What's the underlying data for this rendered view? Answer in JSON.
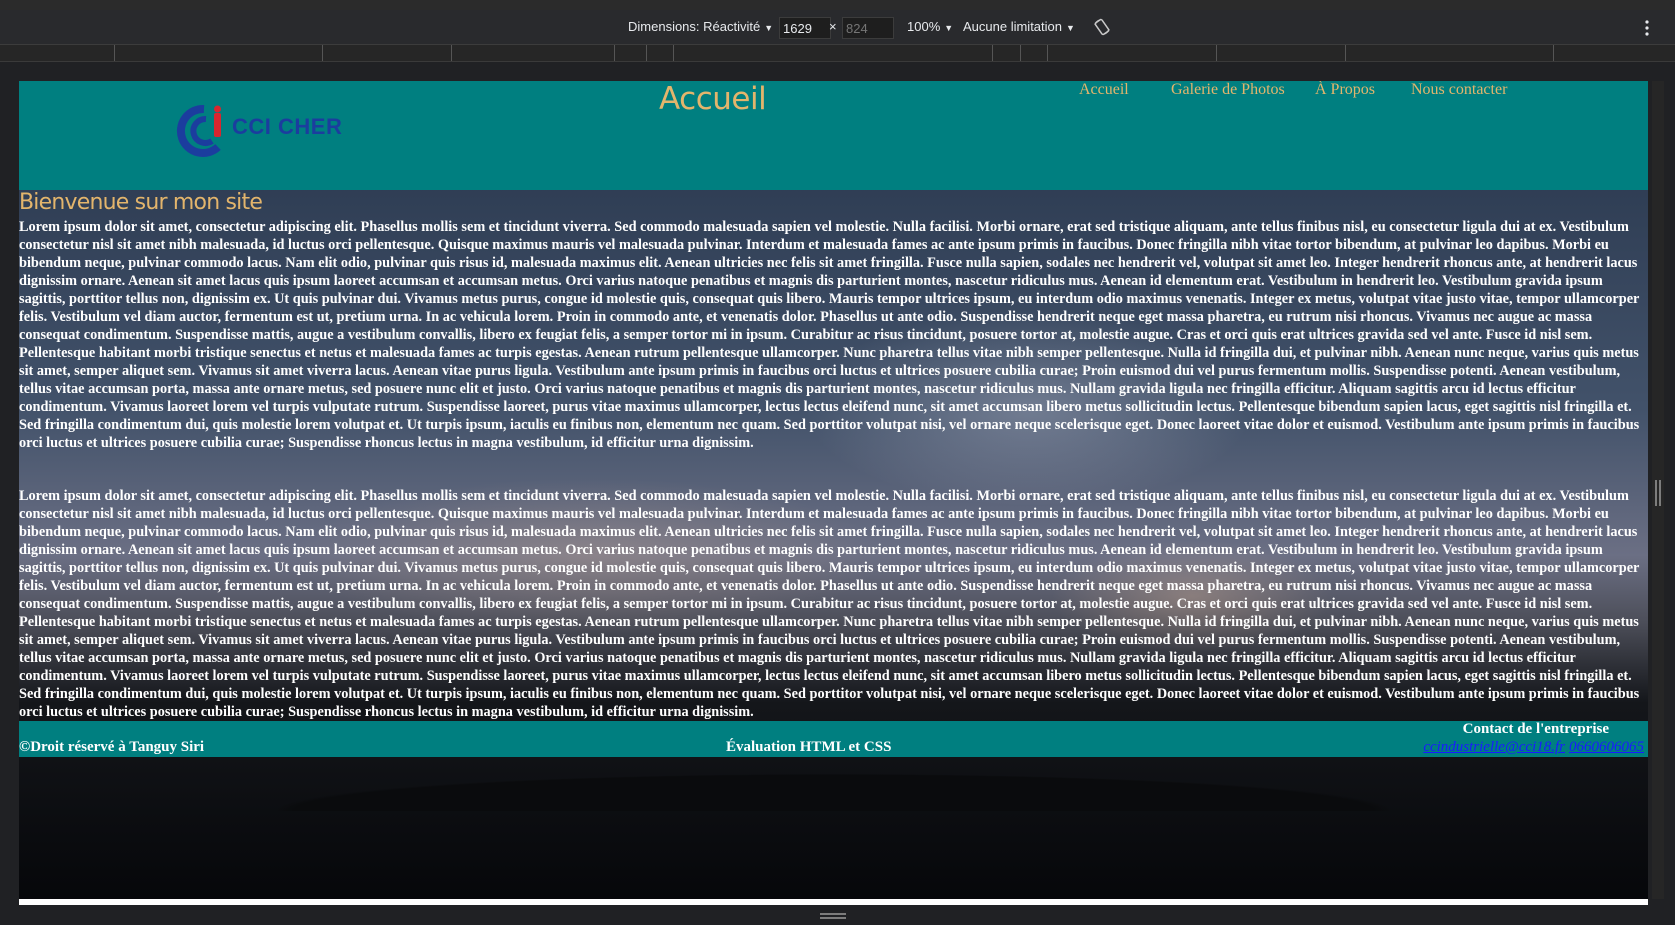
{
  "devtools": {
    "dimensions_label": "Dimensions: Réactivité",
    "width_value": "1629",
    "height_placeholder": "824",
    "times": "×",
    "zoom": "100%",
    "throttling": "Aucune limitation"
  },
  "site": {
    "logo_text": "CCI CHER",
    "page_title": "Accueil",
    "nav": [
      "Accueil",
      "Galerie de Photos",
      "À Propos",
      "Nous contacter"
    ],
    "welcome": "Bienvenue sur mon site",
    "paragraph": "Lorem ipsum dolor sit amet, consectetur adipiscing elit. Phasellus mollis sem et tincidunt viverra. Sed commodo malesuada sapien vel molestie. Nulla facilisi. Morbi ornare, erat sed tristique aliquam, ante tellus finibus nisl, eu consectetur ligula dui at ex. Vestibulum consectetur nisl sit amet nibh malesuada, id luctus orci pellentesque. Quisque maximus mauris vel malesuada pulvinar. Interdum et malesuada fames ac ante ipsum primis in faucibus. Donec fringilla nibh vitae tortor bibendum, at pulvinar leo dapibus. Morbi eu bibendum neque, pulvinar commodo lacus. Nam elit odio, pulvinar quis risus id, malesuada maximus elit. Aenean ultricies nec felis sit amet fringilla. Fusce nulla sapien, sodales nec hendrerit vel, volutpat sit amet leo. Integer hendrerit rhoncus ante, at hendrerit lacus dignissim ornare. Aenean sit amet lacus quis ipsum laoreet accumsan et accumsan metus. Orci varius natoque penatibus et magnis dis parturient montes, nascetur ridiculus mus. Aenean id elementum erat. Vestibulum in hendrerit leo. Vestibulum gravida ipsum sagittis, porttitor tellus non, dignissim ex. Ut quis pulvinar dui. Vivamus metus purus, congue id molestie quis, consequat quis libero. Mauris tempor ultrices ipsum, eu interdum odio maximus venenatis. Integer ex metus, volutpat vitae justo vitae, tempor ullamcorper felis. Vestibulum vel diam auctor, fermentum est ut, pretium urna. In ac vehicula lorem. Proin in commodo ante, et venenatis dolor. Phasellus ut ante odio. Suspendisse hendrerit neque eget massa pharetra, eu rutrum nisi rhoncus. Vivamus nec augue ac massa consequat condimentum. Suspendisse mattis, augue a vestibulum convallis, libero ex feugiat felis, a semper tortor mi in ipsum. Curabitur ac risus tincidunt, posuere tortor at, molestie augue. Cras et orci quis erat ultrices gravida sed vel ante. Fusce id nisl sem. Pellentesque habitant morbi tristique senectus et netus et malesuada fames ac turpis egestas. Aenean rutrum pellentesque ullamcorper. Nunc pharetra tellus vitae nibh semper pellentesque. Nulla id fringilla dui, et pulvinar nibh. Aenean nunc neque, varius quis metus sit amet, semper aliquet sem. Vivamus sit amet viverra lacus. Aenean vitae purus ligula. Vestibulum ante ipsum primis in faucibus orci luctus et ultrices posuere cubilia curae; Proin euismod dui vel purus fermentum mollis. Suspendisse potenti. Aenean vestibulum, tellus vitae accumsan porta, massa ante ornare metus, sed posuere nunc elit et justo. Orci varius natoque penatibus et magnis dis parturient montes, nascetur ridiculus mus. Nullam gravida ligula nec fringilla efficitur. Aliquam sagittis arcu id lectus efficitur condimentum. Vivamus laoreet lorem vel turpis vulputate rutrum. Suspendisse laoreet, purus vitae maximus ullamcorper, lectus lectus eleifend nunc, sit amet accumsan libero metus sollicitudin lectus. Pellentesque bibendum sapien lacus, eget sagittis nisl fringilla et. Sed fringilla condimentum dui, quis molestie lorem volutpat et. Ut turpis ipsum, iaculis eu finibus non, elementum nec quam. Sed porttitor volutpat nisi, vel ornare neque scelerisque eget. Donec laoreet vitae dolor et euismod. Vestibulum ante ipsum primis in faucibus orci luctus et ultrices posuere cubilia curae; Suspendisse rhoncus lectus in magna vestibulum, id efficitur urna dignissim.",
    "footer": {
      "copyright": "©Droit réservé à Tanguy Siri",
      "evaluation": "Évaluation HTML et CSS",
      "contact_title": "Contact de l'entreprise",
      "contact_email": "ccindustrielle@cci18.fr",
      "contact_phone": "0660606065"
    }
  },
  "colors": {
    "header_bg": "#007f80",
    "title_gold": "#e3b56c",
    "logo_blue": "#1b3d9e",
    "logo_red": "#d9262f"
  },
  "icons": [
    "dropdown-caret-icon",
    "rotate-icon",
    "more-vertical-icon",
    "resize-handle-icon"
  ]
}
